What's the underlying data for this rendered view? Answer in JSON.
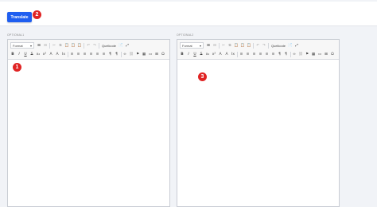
{
  "topbar": {
    "translate_label": "Translate"
  },
  "markers": {
    "m1": "1",
    "m2": "2",
    "m3": "3"
  },
  "fields": {
    "left_label": "OPTIONAL1",
    "right_label": "OPTIONAL2"
  },
  "toolbar": {
    "format_label": "Format",
    "format_arrow": "▾",
    "sourcecode_label": "Quellcode",
    "row1_icons": [
      "⊞",
      "⊟",
      "✂",
      "⧉",
      "📋",
      "📋",
      "📋",
      "↶",
      "↷",
      "📄",
      "⤢"
    ],
    "row2": [
      "B",
      "I",
      "U",
      "S",
      "x₂",
      "x²",
      "A",
      "A",
      "Ix",
      "≡",
      "≡",
      "≡",
      "≡",
      "≡",
      "≡",
      "¶",
      "¶",
      "∞",
      "⛓",
      "⚑",
      "▦",
      "▭",
      "⊞",
      "Ω"
    ]
  },
  "colors": {
    "accent": "#1f5ef0",
    "marker": "#e02424"
  }
}
